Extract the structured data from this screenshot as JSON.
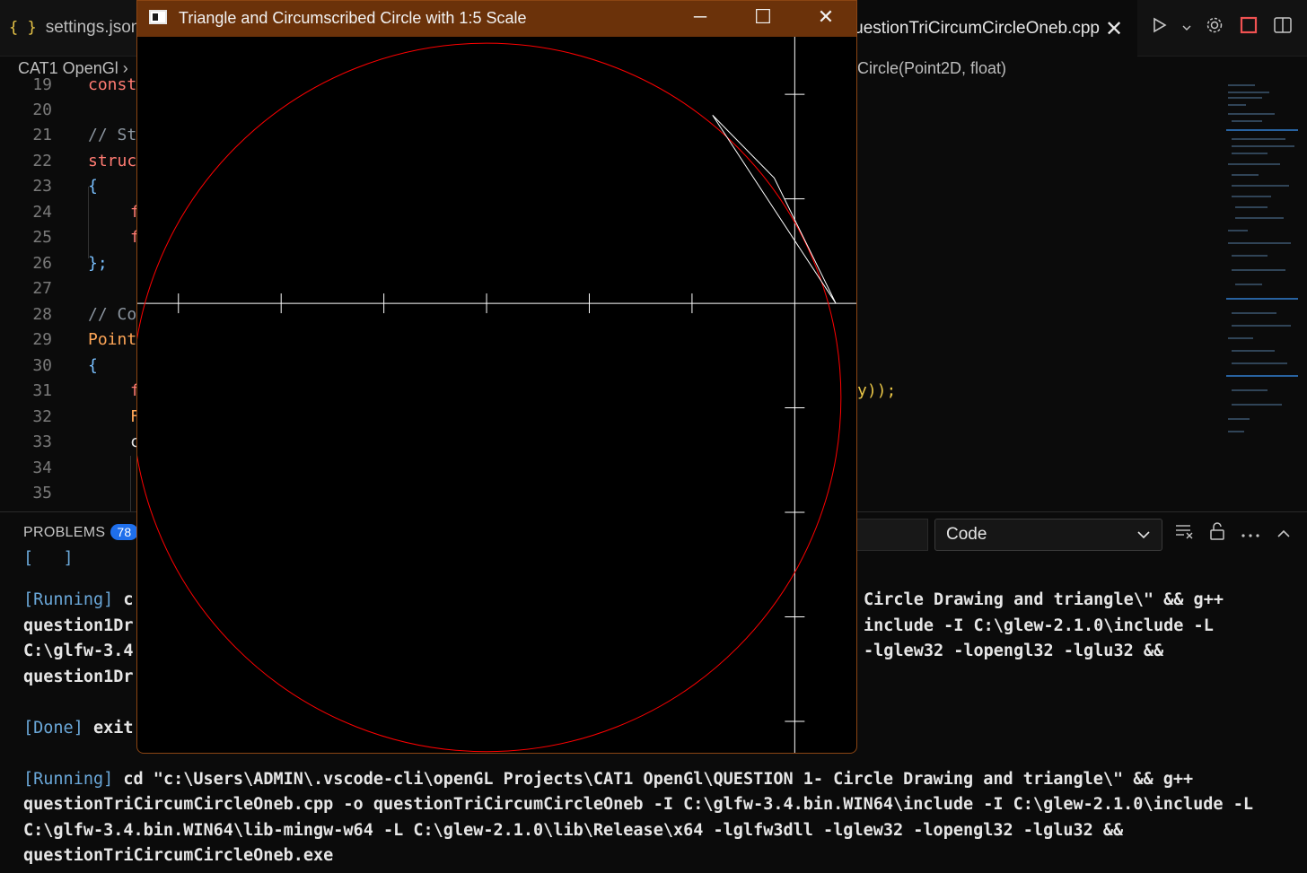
{
  "vscode": {
    "tab_left": {
      "icon": "curly-braces-icon",
      "icon_glyph": "{ }",
      "label": "settings.json"
    },
    "tab_right": {
      "label": "uestionTriCircumCircleOneb.cpp",
      "close_glyph": "✕"
    },
    "breadcrumb_left": "CAT1 OpenGl  ›",
    "breadcrumb_right": "Circle(Point2D, float)",
    "editor": {
      "line_numbers": [
        "19",
        "20",
        "21",
        "22",
        "23",
        "24",
        "25",
        "26",
        "27",
        "28",
        "29",
        "30",
        "31",
        "32",
        "33",
        "34",
        "35"
      ],
      "lines": {
        "l19": "const",
        "l21": "// St",
        "l22": "struc",
        "l23": "{",
        "l24": "f",
        "l25": "f",
        "l26": "};",
        "l28": "// Co",
        "l29": "Point",
        "l30": "{",
        "l31": "f",
        "l32": "F",
        "l33": "c",
        "l31_tail": "y));"
      }
    },
    "panel": {
      "problems_label": "PROBLEMS",
      "problems_count": "78",
      "select_value": "Code",
      "terminal_lines": [
        {
          "tag": "[Running]",
          "text": " c",
          "tail": "Circle Drawing and triangle\\\" && g++"
        },
        {
          "text": "question1Dr",
          "tail": "include -I C:\\glew-2.1.0\\include -L"
        },
        {
          "text": "C:\\glfw-3.4",
          "tail": "-lglew32 -lopengl32 -lglu32 &&"
        },
        {
          "text": "question1Dr"
        },
        {
          "tag": "[Done]",
          "text": " exit"
        },
        {
          "tag": "[Running]",
          "text": " cd \"c:\\Users\\ADMIN\\.vscode-cli\\openGL Projects\\CAT1 OpenGl\\QUESTION 1- Circle Drawing and triangle\\\" && g++"
        },
        {
          "text": "questionTriCircumCircleOneb.cpp -o questionTriCircumCircleOneb -I C:\\glfw-3.4.bin.WIN64\\include -I C:\\glew-2.1.0\\include -L"
        },
        {
          "text": "C:\\glfw-3.4.bin.WIN64\\lib-mingw-w64 -L C:\\glew-2.1.0\\lib\\Release\\x64 -lglfw3dll -lglew32 -lopengl32 -lglu32 &&"
        },
        {
          "text": "questionTriCircumCircleOneb.exe"
        }
      ]
    },
    "actions": [
      "run-icon",
      "chevron-down-icon",
      "gear-icon",
      "stop-icon",
      "split-editor-icon"
    ],
    "panel_icons": [
      "clear-output-icon",
      "lock-icon",
      "more-icon",
      "chevron-up-icon"
    ]
  },
  "gl_window": {
    "title": "Triangle and Circumscribed Circle with 1:5 Scale",
    "buttons": {
      "minimize": "─",
      "maximize": "☐",
      "close": "✕"
    },
    "scene": {
      "circle_color": "#ff0000",
      "axis_color": "#ffffff",
      "triangle_color": "#ffffff",
      "circle_center": [
        -3,
        -0.9
      ],
      "circle_radius": 3.45,
      "triangle": [
        [
          0.4,
          0
        ],
        [
          -0.8,
          1.8
        ],
        [
          -0.2,
          1.2
        ]
      ],
      "x_range": [
        -6.4,
        0.6
      ],
      "y_range": [
        -4.3,
        2.55
      ],
      "tick_spacing": 1
    },
    "colors": {
      "titlebar": "#6b320a",
      "border": "#8b4513"
    }
  }
}
